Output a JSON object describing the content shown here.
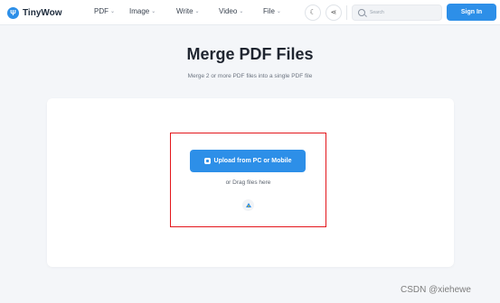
{
  "header": {
    "logo_glyph": "Ψ",
    "brand": "TinyWow",
    "nav": [
      {
        "label": "PDF"
      },
      {
        "label": "Image"
      },
      {
        "label": "Write"
      },
      {
        "label": "Video"
      },
      {
        "label": "File"
      }
    ],
    "chevron_glyph": "⌄",
    "theme_icon_glyph": "☾",
    "share_icon_glyph": "⋖",
    "search": {
      "placeholder": "Search",
      "value": ""
    },
    "signin_label": "Sign In"
  },
  "main": {
    "title": "Merge PDF Files",
    "subtitle": "Merge 2 or more PDF files into a single PDF file",
    "upload_label": "Upload from PC or Mobile",
    "drag_label": "or Drag files here"
  },
  "watermark": "CSDN @xiehewe",
  "colors": {
    "accent": "#2d8fe8",
    "highlight_border": "#e3161b",
    "page_background": "#f4f6f9"
  },
  "icons": [
    "logo-icon",
    "chevron-down-icon",
    "moon-icon",
    "share-icon",
    "search-icon",
    "upload-icon",
    "google-drive-icon"
  ]
}
